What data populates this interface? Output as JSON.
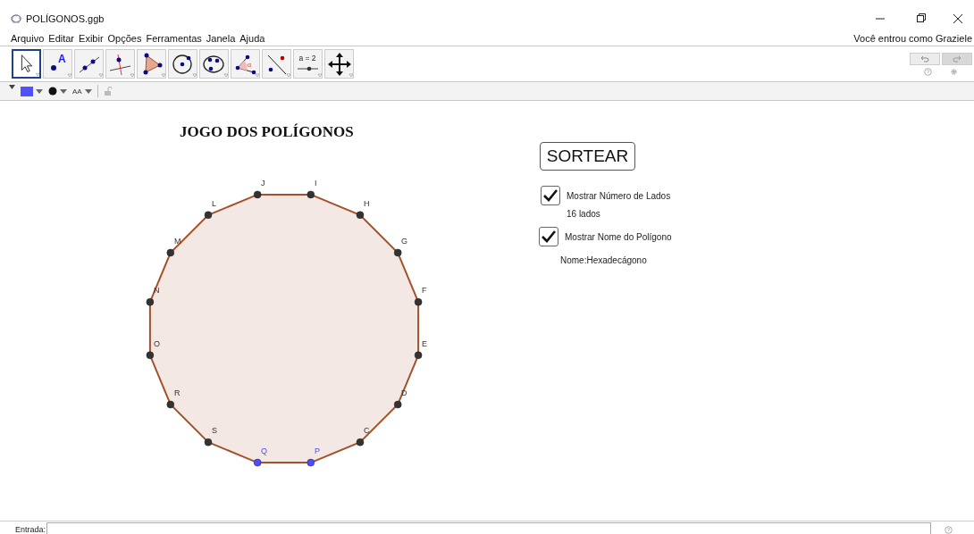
{
  "window": {
    "title": "POLÍGONOS.ggb"
  },
  "menu": [
    "Arquivo",
    "Editar",
    "Exibir",
    "Opções",
    "Ferramentas",
    "Janela",
    "Ajuda"
  ],
  "user_status": "Você entrou como Graziele",
  "tools": [
    {
      "kind": "move",
      "selected": true
    },
    {
      "kind": "point",
      "selected": false,
      "text": "A"
    },
    {
      "kind": "line",
      "selected": false
    },
    {
      "kind": "perpendicular",
      "selected": false
    },
    {
      "kind": "polygon",
      "selected": false
    },
    {
      "kind": "circle",
      "selected": false
    },
    {
      "kind": "conic",
      "selected": false
    },
    {
      "kind": "angle",
      "selected": false,
      "text": "α"
    },
    {
      "kind": "reflect",
      "selected": false
    },
    {
      "kind": "slider",
      "selected": false,
      "text": "a = 2"
    },
    {
      "kind": "move-view",
      "selected": false
    }
  ],
  "style_bar": {
    "color": "#5050ff",
    "text_size": "AA"
  },
  "graphics": {
    "title": "JOGO DOS POLÍGONOS",
    "button": "SORTEAR",
    "checkboxes": [
      {
        "label": "Mostrar Número de Lados",
        "checked": true,
        "result": "16 lados"
      },
      {
        "label": "Mostrar Nome do Polígono",
        "checked": true,
        "result": "Nome:Hexadecágono"
      }
    ],
    "polygon": {
      "vertices": [
        {
          "label": "I",
          "color": "#333333"
        },
        {
          "label": "H",
          "color": "#333333"
        },
        {
          "label": "G",
          "color": "#333333"
        },
        {
          "label": "F",
          "color": "#333333"
        },
        {
          "label": "E",
          "color": "#333333"
        },
        {
          "label": "D",
          "color": "#333333"
        },
        {
          "label": "C",
          "color": "#333333"
        },
        {
          "label": "P",
          "color": "#4d4dff"
        },
        {
          "label": "Q",
          "color": "#4d4dff"
        },
        {
          "label": "S",
          "color": "#333333"
        },
        {
          "label": "R",
          "color": "#333333"
        },
        {
          "label": "O",
          "color": "#333333"
        },
        {
          "label": "N",
          "color": "#333333"
        },
        {
          "label": "M",
          "color": "#333333"
        },
        {
          "label": "L",
          "color": "#333333"
        },
        {
          "label": "J",
          "color": "#333333"
        }
      ]
    }
  },
  "input_bar": {
    "label": "Entrada:"
  }
}
